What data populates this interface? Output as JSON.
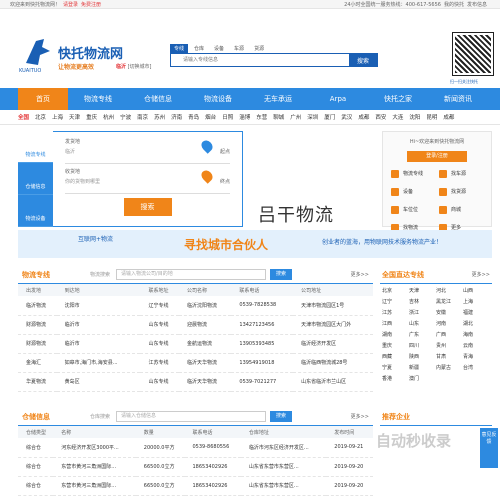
{
  "topbar": {
    "welcome": "欢迎来到快托物流网！",
    "login": "请登录",
    "register": "免费注册",
    "hotline": "24小时全国统一服务热线：400-617-5656",
    "my": "我的快托",
    "issue": "发布信息",
    "help": "帮助中心",
    "notice": "行业新闻"
  },
  "header": {
    "brand": "快托物流网",
    "logo_text": "KUAITUO",
    "slogan": "让物流更高效",
    "city": "临沂",
    "switch": "[切换城市]",
    "tabs": [
      "专线",
      "仓库",
      "设备",
      "车源",
      "货源"
    ],
    "search_placeholder": "请输入专线信息",
    "search_btn": "搜索",
    "qr_text": "扫一扫关注快托"
  },
  "nav": [
    "首页",
    "物流专线",
    "仓储信息",
    "物流设备",
    "无车承运",
    "Arpa",
    "快托之家",
    "新闻资讯"
  ],
  "cities": {
    "label": "全国",
    "items": [
      "北京",
      "上海",
      "天津",
      "重庆",
      "杭州",
      "宁波",
      "南京",
      "苏州",
      "济南",
      "青岛",
      "烟台",
      "日照",
      "淄博",
      "东营",
      "聊城",
      "广州",
      "深圳",
      "厦门",
      "武汉",
      "成都",
      "西安",
      "大连",
      "沈阳",
      "昆明",
      "成都"
    ]
  },
  "side": [
    "物流专线",
    "仓储信息",
    "物流设备"
  ],
  "form": {
    "from_label": "发货地",
    "from_value": "临沂",
    "to_label": "收货地",
    "to_value": "你的货物到哪里",
    "start": "起点",
    "end": "终点",
    "submit": "搜索"
  },
  "banner": {
    "text": "吕干物流"
  },
  "user": {
    "hi": "Hi~欢迎来到快托物流网",
    "btn": "登录/注册",
    "items": [
      "物流专线",
      "找车源",
      "设备",
      "找货源",
      "车位位",
      "商城",
      "找物流",
      "更多"
    ]
  },
  "ad": {
    "t1": "互联网+物流",
    "t2": "寻找城市合伙人",
    "t3": "创业者的蓝海，用物联网技术服务物流产业！"
  },
  "lines": {
    "title": "物流专线",
    "search_label": "物流搜索",
    "placeholder": "请输入物流公司/目的地",
    "btn": "搜索",
    "more": "更多>>",
    "headers": [
      "出发地",
      "到达地",
      "联系地址",
      "公司名称",
      "联系电话",
      "公司地址"
    ],
    "rows": [
      [
        "临沂物流",
        "沈阳市",
        "辽宁专线",
        "临沂沈阳物流",
        "0539-7828538",
        "天津市物流园区1号"
      ],
      [
        "财源物流",
        "临沂市",
        "山东专线",
        "迎晨物流",
        "13427123456",
        "天津市物流园区大门外"
      ],
      [
        "财源物流",
        "临沂市",
        "山东专线",
        "金航运物流",
        "13905393485",
        "临沂经济开发区"
      ],
      [
        "金海汇",
        "如皋市,海门市,海安县...",
        "江苏专线",
        "临沂天华物流",
        "13954919018",
        "临沂临西物流城28号"
      ],
      [
        "华夏物流",
        "黄岛区",
        "山东专线",
        "临沂天华物流",
        "0539-7021277",
        "山东省临沂市兰山区"
      ]
    ]
  },
  "cities_panel": {
    "title": "全国直达专线",
    "more": "更多>>",
    "items": [
      "北京",
      "天津",
      "河北",
      "山西",
      "辽宁",
      "吉林",
      "黑龙江",
      "上海",
      "江苏",
      "浙江",
      "安徽",
      "福建",
      "江西",
      "山东",
      "河南",
      "湖北",
      "湖南",
      "广东",
      "广西",
      "海南",
      "重庆",
      "四川",
      "贵州",
      "云南",
      "西藏",
      "陕西",
      "甘肃",
      "青海",
      "宁夏",
      "新疆",
      "内蒙古",
      "台湾",
      "香港",
      "澳门"
    ]
  },
  "warehouse": {
    "title": "仓储信息",
    "search_label": "仓库搜索",
    "placeholder": "请输入仓储信息",
    "btn": "搜索",
    "more": "更多>>",
    "headers": [
      "仓储类型",
      "名称",
      "数量",
      "联系电话",
      "仓库地址",
      "发布时间"
    ],
    "rows": [
      [
        "综合仓",
        "河东经济开发区3000平...",
        "20000.0平方",
        "0539-8680556",
        "临沂市河东区经济开发区...",
        "2019-09-21"
      ],
      [
        "综合仓",
        "东营市黄河三角洲国际...",
        "66500.0立方",
        "18653402926",
        "山东省东营市东营区...",
        "2019-09-20"
      ],
      [
        "综合仓",
        "东营市黄河三角洲国际...",
        "66500.0立方",
        "18653402926",
        "山东省东营市东营区...",
        "2019-09-20"
      ]
    ]
  },
  "recommend": {
    "title": "推荐企业"
  },
  "watermark": "自动秒收录",
  "float_btn": "意见反馈"
}
